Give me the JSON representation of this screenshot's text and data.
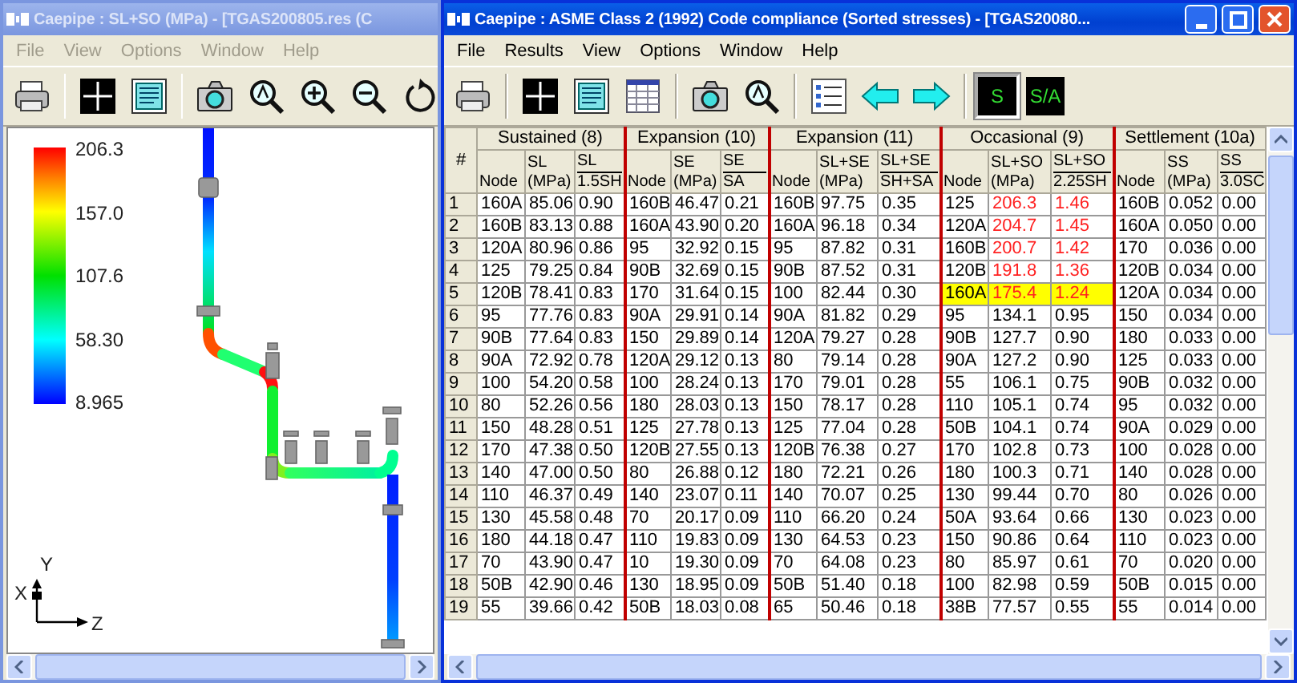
{
  "left_window": {
    "title": "Caepipe : SL+SO (MPa) -  [TGAS200805.res (C",
    "active": false,
    "menu": [
      "File",
      "View",
      "Options",
      "Window",
      "Help"
    ],
    "legend": [
      "206.3",
      "157.0",
      "107.6",
      "58.30",
      "8.965"
    ],
    "axes": {
      "x": "X",
      "y": "Y",
      "z": "Z"
    }
  },
  "right_window": {
    "title": "Caepipe : ASME Class 2 (1992) Code compliance (Sorted stresses) -  [TGAS20080...",
    "active": true,
    "menu": [
      "File",
      "Results",
      "View",
      "Options",
      "Window",
      "Help"
    ],
    "toolbar_buttons": [
      {
        "label": "S",
        "pressed": true
      },
      {
        "label": "S/A",
        "pressed": false
      }
    ],
    "table": {
      "corner": "#",
      "groups": [
        {
          "title": "Sustained (8)",
          "columns": [
            {
              "kind": "plain",
              "text": "Node"
            },
            {
              "kind": "plain",
              "text": "SL\n(MPa)"
            },
            {
              "kind": "fraction",
              "top": "SL",
              "bottom": "1.5SH"
            }
          ]
        },
        {
          "title": "Expansion (10)",
          "columns": [
            {
              "kind": "plain",
              "text": "Node"
            },
            {
              "kind": "plain",
              "text": "SE\n(MPa)"
            },
            {
              "kind": "fraction",
              "top": "SE",
              "bottom": "SA"
            }
          ]
        },
        {
          "title": "Expansion (11)",
          "columns": [
            {
              "kind": "plain",
              "text": "Node"
            },
            {
              "kind": "plain",
              "text": "SL+SE\n(MPa)"
            },
            {
              "kind": "fraction",
              "top": "SL+SE",
              "bottom": "SH+SA"
            }
          ]
        },
        {
          "title": "Occasional (9)",
          "columns": [
            {
              "kind": "plain",
              "text": "Node"
            },
            {
              "kind": "plain",
              "text": "SL+SO\n(MPa)"
            },
            {
              "kind": "fraction",
              "top": "SL+SO",
              "bottom": "2.25SH"
            }
          ]
        },
        {
          "title": "Settlement (10a)",
          "columns": [
            {
              "kind": "plain",
              "text": "Node"
            },
            {
              "kind": "plain",
              "text": "SS\n(MPa)"
            },
            {
              "kind": "fraction",
              "top": "SS",
              "bottom": "3.0SC"
            }
          ]
        }
      ],
      "rows": [
        {
          "number": "1",
          "flagged": true,
          "selected": false,
          "cells": [
            "160A",
            "85.06",
            "0.90",
            "160B",
            "46.47",
            "0.21",
            "160B",
            "97.75",
            "0.35",
            "125",
            "206.3",
            "1.46",
            "160B",
            "0.052",
            "0.00"
          ]
        },
        {
          "number": "2",
          "flagged": true,
          "selected": false,
          "cells": [
            "160B",
            "83.13",
            "0.88",
            "160A",
            "43.90",
            "0.20",
            "160A",
            "96.18",
            "0.34",
            "120A",
            "204.7",
            "1.45",
            "160A",
            "0.050",
            "0.00"
          ]
        },
        {
          "number": "3",
          "flagged": true,
          "selected": false,
          "cells": [
            "120A",
            "80.96",
            "0.86",
            "95",
            "32.92",
            "0.15",
            "95",
            "87.82",
            "0.31",
            "160B",
            "200.7",
            "1.42",
            "170",
            "0.036",
            "0.00"
          ]
        },
        {
          "number": "4",
          "flagged": true,
          "selected": false,
          "cells": [
            "125",
            "79.25",
            "0.84",
            "90B",
            "32.69",
            "0.15",
            "90B",
            "87.52",
            "0.31",
            "120B",
            "191.8",
            "1.36",
            "120B",
            "0.034",
            "0.00"
          ]
        },
        {
          "number": "5",
          "flagged": true,
          "selected": true,
          "cells": [
            "120B",
            "78.41",
            "0.83",
            "170",
            "31.64",
            "0.15",
            "100",
            "82.44",
            "0.30",
            "160A",
            "175.4",
            "1.24",
            "120A",
            "0.034",
            "0.00"
          ]
        },
        {
          "number": "6",
          "flagged": false,
          "selected": false,
          "cells": [
            "95",
            "77.76",
            "0.83",
            "90A",
            "29.91",
            "0.14",
            "90A",
            "81.82",
            "0.29",
            "95",
            "134.1",
            "0.95",
            "150",
            "0.034",
            "0.00"
          ]
        },
        {
          "number": "7",
          "flagged": false,
          "selected": false,
          "cells": [
            "90B",
            "77.64",
            "0.83",
            "150",
            "29.89",
            "0.14",
            "120A",
            "79.27",
            "0.28",
            "90B",
            "127.7",
            "0.90",
            "180",
            "0.033",
            "0.00"
          ]
        },
        {
          "number": "8",
          "flagged": false,
          "selected": false,
          "cells": [
            "90A",
            "72.92",
            "0.78",
            "120A",
            "29.12",
            "0.13",
            "80",
            "79.14",
            "0.28",
            "90A",
            "127.2",
            "0.90",
            "125",
            "0.033",
            "0.00"
          ]
        },
        {
          "number": "9",
          "flagged": false,
          "selected": false,
          "cells": [
            "100",
            "54.20",
            "0.58",
            "100",
            "28.24",
            "0.13",
            "170",
            "79.01",
            "0.28",
            "55",
            "106.1",
            "0.75",
            "90B",
            "0.032",
            "0.00"
          ]
        },
        {
          "number": "10",
          "flagged": false,
          "selected": false,
          "cells": [
            "80",
            "52.26",
            "0.56",
            "180",
            "28.03",
            "0.13",
            "150",
            "78.17",
            "0.28",
            "110",
            "105.1",
            "0.74",
            "95",
            "0.032",
            "0.00"
          ]
        },
        {
          "number": "11",
          "flagged": false,
          "selected": false,
          "cells": [
            "150",
            "48.28",
            "0.51",
            "125",
            "27.78",
            "0.13",
            "125",
            "77.04",
            "0.28",
            "50B",
            "104.1",
            "0.74",
            "90A",
            "0.029",
            "0.00"
          ]
        },
        {
          "number": "12",
          "flagged": false,
          "selected": false,
          "cells": [
            "170",
            "47.38",
            "0.50",
            "120B",
            "27.55",
            "0.13",
            "120B",
            "76.38",
            "0.27",
            "170",
            "102.8",
            "0.73",
            "100",
            "0.028",
            "0.00"
          ]
        },
        {
          "number": "13",
          "flagged": false,
          "selected": false,
          "cells": [
            "140",
            "47.00",
            "0.50",
            "80",
            "26.88",
            "0.12",
            "180",
            "72.21",
            "0.26",
            "180",
            "100.3",
            "0.71",
            "140",
            "0.028",
            "0.00"
          ]
        },
        {
          "number": "14",
          "flagged": false,
          "selected": false,
          "cells": [
            "110",
            "46.37",
            "0.49",
            "140",
            "23.07",
            "0.11",
            "140",
            "70.07",
            "0.25",
            "130",
            "99.44",
            "0.70",
            "80",
            "0.026",
            "0.00"
          ]
        },
        {
          "number": "15",
          "flagged": false,
          "selected": false,
          "cells": [
            "130",
            "45.58",
            "0.48",
            "70",
            "20.17",
            "0.09",
            "110",
            "66.20",
            "0.24",
            "50A",
            "93.64",
            "0.66",
            "130",
            "0.023",
            "0.00"
          ]
        },
        {
          "number": "16",
          "flagged": false,
          "selected": false,
          "cells": [
            "180",
            "44.18",
            "0.47",
            "110",
            "19.83",
            "0.09",
            "130",
            "64.53",
            "0.23",
            "150",
            "90.86",
            "0.64",
            "110",
            "0.023",
            "0.00"
          ]
        },
        {
          "number": "17",
          "flagged": false,
          "selected": false,
          "cells": [
            "70",
            "43.90",
            "0.47",
            "10",
            "19.30",
            "0.09",
            "70",
            "64.08",
            "0.23",
            "80",
            "85.97",
            "0.61",
            "70",
            "0.020",
            "0.00"
          ]
        },
        {
          "number": "18",
          "flagged": false,
          "selected": false,
          "cells": [
            "50B",
            "42.90",
            "0.46",
            "130",
            "18.95",
            "0.09",
            "50B",
            "51.40",
            "0.18",
            "100",
            "82.98",
            "0.59",
            "50B",
            "0.015",
            "0.00"
          ]
        },
        {
          "number": "19",
          "flagged": false,
          "selected": false,
          "cells": [
            "55",
            "39.66",
            "0.42",
            "50B",
            "18.03",
            "0.08",
            "65",
            "50.46",
            "0.18",
            "38B",
            "77.57",
            "0.55",
            "55",
            "0.014",
            "0.00"
          ]
        }
      ]
    }
  }
}
